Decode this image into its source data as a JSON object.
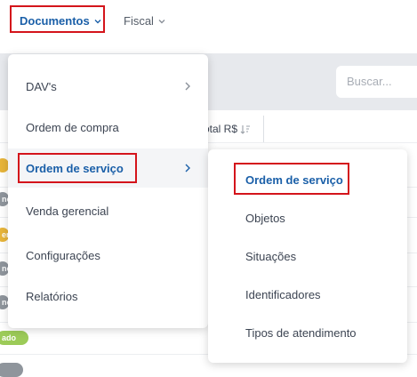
{
  "topnav": {
    "documentos_label": "Documentos",
    "fiscal_label": "Fiscal"
  },
  "search": {
    "placeholder": "Buscar..."
  },
  "table": {
    "header_total": "otal R$"
  },
  "badges": [
    {
      "text": "",
      "color": "#e8b53a"
    },
    {
      "text": "no",
      "color": "#8f959c"
    },
    {
      "text": "er",
      "color": "#e8b53a"
    },
    {
      "text": "no",
      "color": "#8f959c"
    },
    {
      "text": "no",
      "color": "#8f959c"
    },
    {
      "text": "ado",
      "color": "#9ccb58"
    },
    {
      "text": "",
      "color": "#8f959c"
    }
  ],
  "menu": {
    "items": [
      {
        "label": "DAV's",
        "has_submenu": true
      },
      {
        "label": "Ordem de compra",
        "has_submenu": false
      },
      {
        "label": "Ordem de serviço",
        "has_submenu": true,
        "active": true
      },
      {
        "label": "Venda gerencial",
        "has_submenu": false
      },
      {
        "label": "Configurações",
        "has_submenu": false
      },
      {
        "label": "Relatórios",
        "has_submenu": false
      }
    ]
  },
  "submenu": {
    "items": [
      {
        "label": "Ordem de serviço",
        "active": true
      },
      {
        "label": "Objetos"
      },
      {
        "label": "Situações"
      },
      {
        "label": "Identificadores"
      },
      {
        "label": "Tipos de atendimento"
      }
    ]
  },
  "colors": {
    "accent": "#1a5fa8",
    "highlight_border": "#d4141b",
    "page_band": "#e7e9ed"
  }
}
